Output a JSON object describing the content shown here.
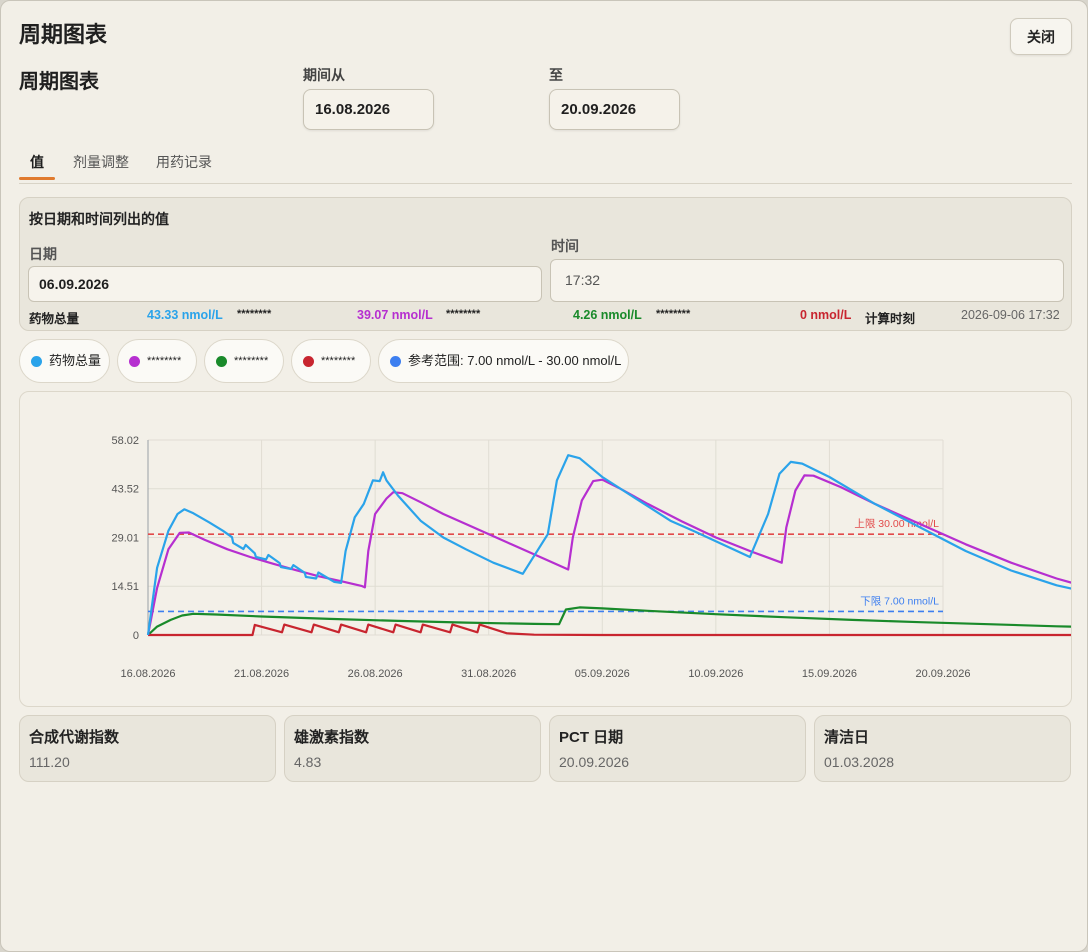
{
  "window": {
    "title": "周期图表",
    "close_label": "关闭"
  },
  "header": {
    "section_title": "周期图表",
    "from_label": "期间从",
    "from_value": "16.08.2026",
    "to_label": "至",
    "to_value": "20.09.2026"
  },
  "tabs": [
    {
      "label": "值",
      "active": true
    },
    {
      "label": "剂量调整",
      "active": false
    },
    {
      "label": "用药记录",
      "active": false
    }
  ],
  "values_panel": {
    "title": "按日期和时间列出的值",
    "date_label": "日期",
    "date_value": "06.09.2026",
    "time_label": "时间",
    "time_value": "17:32",
    "total_label": "药物总量",
    "total_value": "43.33 nmol/L",
    "mask1": "********",
    "value_purple": "39.07 nmol/L",
    "mask2": "********",
    "value_green": "4.26 nmol/L",
    "mask3": "********",
    "value_red": "0 nmol/L",
    "calc_label": "计算时刻",
    "calc_value": "2026-09-06 17:32"
  },
  "legend": [
    {
      "label": "药物总量",
      "color": "#2aa3ea"
    },
    {
      "label": "********",
      "color": "#b62fd0"
    },
    {
      "label": "********",
      "color": "#198a2a"
    },
    {
      "label": "********",
      "color": "#c8252f"
    },
    {
      "label": "参考范围: 7.00 nmol/L - 30.00 nmol/L",
      "color": "#3d7ff0"
    }
  ],
  "stats": [
    {
      "title": "合成代谢指数",
      "value": "111.20"
    },
    {
      "title": "雄激素指数",
      "value": "4.83"
    },
    {
      "title": "PCT 日期",
      "value": "20.09.2026"
    },
    {
      "title": "清洁日",
      "value": "01.03.2028"
    }
  ],
  "chart_data": {
    "type": "line",
    "x_start": "16.08.2026",
    "x_end": "20.09.2026",
    "x_ticks": [
      "16.08.2026",
      "21.08.2026",
      "26.08.2026",
      "31.08.2026",
      "05.09.2026",
      "10.09.2026",
      "15.09.2026",
      "20.09.2026"
    ],
    "y_ticks": [
      "0",
      "14.51",
      "29.01",
      "43.52",
      "58.02"
    ],
    "ylim": [
      0,
      58.02
    ],
    "grid": true,
    "ref_lines": [
      {
        "label": "上限 30.00 nmol/L",
        "value": 30,
        "color": "#e24a4a"
      },
      {
        "label": "下限 7.00 nmol/L",
        "value": 7,
        "color": "#3d7ff0"
      }
    ],
    "series": [
      {
        "name": "药物总量",
        "color": "#2aa3ea",
        "points": [
          [
            0,
            0
          ],
          [
            0.4,
            20
          ],
          [
            0.9,
            31
          ],
          [
            1.3,
            36
          ],
          [
            1.6,
            37.4
          ],
          [
            2,
            36.2
          ],
          [
            2.7,
            33.5
          ],
          [
            3.3,
            31
          ],
          [
            3.7,
            29.1
          ],
          [
            3.75,
            27.4
          ],
          [
            4.2,
            25.6
          ],
          [
            4.3,
            26.8
          ],
          [
            4.7,
            24.3
          ],
          [
            4.75,
            23.2
          ],
          [
            5.2,
            22.5
          ],
          [
            5.3,
            23.8
          ],
          [
            5.8,
            21.4
          ],
          [
            5.85,
            20.2
          ],
          [
            6.3,
            19.6
          ],
          [
            6.4,
            20.8
          ],
          [
            6.9,
            18.5
          ],
          [
            6.95,
            17.3
          ],
          [
            7.4,
            16.8
          ],
          [
            7.5,
            18.6
          ],
          [
            7.8,
            17.4
          ],
          [
            8.2,
            15.8
          ],
          [
            8.5,
            15.5
          ],
          [
            8.7,
            25
          ],
          [
            9.1,
            35
          ],
          [
            9.5,
            39
          ],
          [
            9.9,
            46
          ],
          [
            10.2,
            45.8
          ],
          [
            10.35,
            48.4
          ],
          [
            10.5,
            46
          ],
          [
            11,
            41.5
          ],
          [
            12,
            34
          ],
          [
            13,
            29
          ],
          [
            14,
            25.5
          ],
          [
            15.2,
            21.5
          ],
          [
            16.5,
            18.2
          ],
          [
            17.6,
            30
          ],
          [
            18,
            46
          ],
          [
            18.5,
            53.5
          ],
          [
            19,
            52.6
          ],
          [
            20,
            47
          ],
          [
            21.5,
            40.5
          ],
          [
            23,
            34
          ],
          [
            24,
            31
          ],
          [
            26.5,
            23.2
          ],
          [
            27.3,
            36
          ],
          [
            27.8,
            48
          ],
          [
            28.3,
            51.5
          ],
          [
            28.8,
            51
          ],
          [
            30,
            47
          ],
          [
            32,
            39
          ],
          [
            34,
            32
          ],
          [
            36,
            25
          ],
          [
            38,
            19.2
          ],
          [
            40,
            14.8
          ],
          [
            42,
            11.8
          ],
          [
            44,
            9.6
          ],
          [
            45.5,
            8.4
          ],
          [
            46.9,
            7.3
          ]
        ]
      },
      {
        "name": "********",
        "color": "#b62fd0",
        "points": [
          [
            0,
            0
          ],
          [
            0.4,
            14
          ],
          [
            0.9,
            25.5
          ],
          [
            1.4,
            30.4
          ],
          [
            1.8,
            30.5
          ],
          [
            2.5,
            28.3
          ],
          [
            3.5,
            25.5
          ],
          [
            4.5,
            23.2
          ],
          [
            5.5,
            21.2
          ],
          [
            6.5,
            19.3
          ],
          [
            7.5,
            17.5
          ],
          [
            8.5,
            16
          ],
          [
            9.4,
            14.6
          ],
          [
            9.55,
            14.2
          ],
          [
            9.7,
            25
          ],
          [
            10,
            36
          ],
          [
            10.5,
            40.6
          ],
          [
            10.8,
            42.5
          ],
          [
            11.2,
            42.2
          ],
          [
            12,
            39.5
          ],
          [
            13,
            36
          ],
          [
            14.5,
            31.5
          ],
          [
            16,
            27
          ],
          [
            17.5,
            22.5
          ],
          [
            18.5,
            19.5
          ],
          [
            18.7,
            29
          ],
          [
            19.1,
            40
          ],
          [
            19.6,
            45.8
          ],
          [
            20,
            46.2
          ],
          [
            20.8,
            43.5
          ],
          [
            22,
            39
          ],
          [
            23.5,
            33.8
          ],
          [
            25,
            29
          ],
          [
            26.5,
            25
          ],
          [
            27.9,
            21.5
          ],
          [
            28.1,
            32
          ],
          [
            28.5,
            43
          ],
          [
            28.9,
            47.5
          ],
          [
            29.3,
            47.4
          ],
          [
            30.5,
            44
          ],
          [
            32,
            39
          ],
          [
            34,
            33
          ],
          [
            36,
            27
          ],
          [
            38,
            21.5
          ],
          [
            40,
            16.8
          ],
          [
            42,
            13
          ],
          [
            44,
            10.3
          ],
          [
            46,
            8.1
          ],
          [
            46.9,
            7.2
          ]
        ]
      },
      {
        "name": "********",
        "color": "#198a2a",
        "points": [
          [
            0,
            0
          ],
          [
            0.4,
            2.5
          ],
          [
            1,
            4.5
          ],
          [
            1.5,
            5.8
          ],
          [
            2,
            6.3
          ],
          [
            3,
            6.1
          ],
          [
            5,
            5.5
          ],
          [
            8,
            4.8
          ],
          [
            11,
            4.2
          ],
          [
            14,
            3.7
          ],
          [
            17,
            3.3
          ],
          [
            18.1,
            3.2
          ],
          [
            18.4,
            7.6
          ],
          [
            19,
            8.2
          ],
          [
            20,
            7.9
          ],
          [
            22,
            7.2
          ],
          [
            25,
            6.2
          ],
          [
            28,
            5.3
          ],
          [
            31,
            4.5
          ],
          [
            34,
            3.8
          ],
          [
            37,
            3.2
          ],
          [
            40,
            2.6
          ],
          [
            43,
            2.1
          ],
          [
            46.9,
            1.6
          ]
        ]
      },
      {
        "name": "********",
        "color": "#c8252f",
        "points": [
          [
            0,
            0
          ],
          [
            2,
            0
          ],
          [
            4,
            0
          ],
          [
            4.6,
            0
          ],
          [
            4.7,
            3
          ],
          [
            5.9,
            0.8
          ],
          [
            6,
            3.1
          ],
          [
            7.2,
            0.8
          ],
          [
            7.3,
            3.1
          ],
          [
            8.4,
            0.8
          ],
          [
            8.5,
            3.1
          ],
          [
            9.6,
            0.8
          ],
          [
            9.7,
            3.1
          ],
          [
            10.8,
            0.8
          ],
          [
            10.9,
            3.1
          ],
          [
            12,
            0.8
          ],
          [
            12.1,
            3.1
          ],
          [
            13.3,
            0.8
          ],
          [
            13.4,
            3.1
          ],
          [
            14.5,
            0.8
          ],
          [
            14.6,
            3.1
          ],
          [
            15.8,
            0.5
          ],
          [
            17,
            0.1
          ],
          [
            20,
            0
          ],
          [
            30,
            0
          ],
          [
            40,
            0
          ],
          [
            46.9,
            0
          ]
        ]
      }
    ]
  }
}
